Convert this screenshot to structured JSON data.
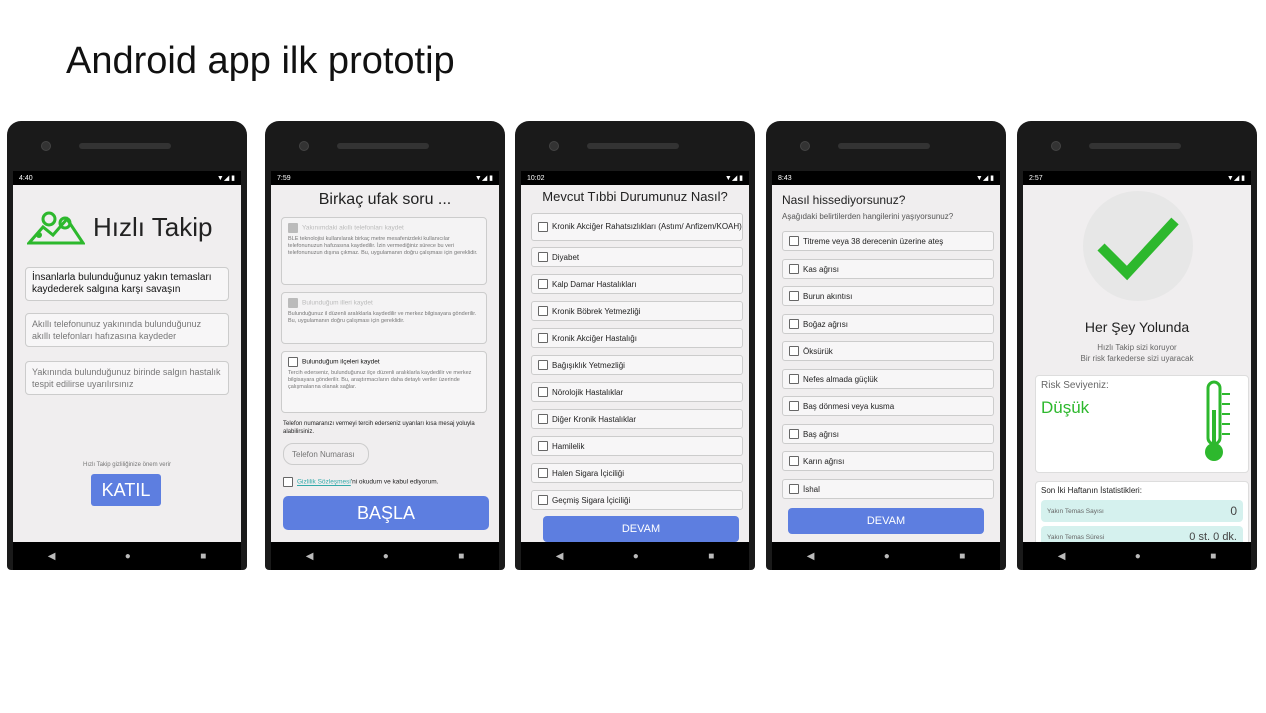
{
  "slide_title": "Android app ilk prototip",
  "phone1": {
    "time": "4:40",
    "app_name": "Hızlı Takip",
    "tagline": "İnsanlarla bulunduğunuz yakın temasları kaydederek salgına karşı savaşın",
    "info1": "Akıllı telefonunuz yakınında bulunduğunuz akıllı telefonları hafızasına kaydeder",
    "info2": "Yakınında bulunduğunuz birinde salgın hastalık tespit edilirse uyarılırsınız",
    "privacy_note": "Hızlı Takip gizliliğinize önem verir",
    "join_button": "KATIL"
  },
  "phone2": {
    "time": "7:59",
    "title": "Birkaç ufak soru ...",
    "q1_title": "Yakınımdaki akıllı telefonları kaydet",
    "q1_body": "BLE teknolojisi kullanılarak birkaç metre mesafenizdeki kullanıcılar telefonunuzun hafızasına kaydedilir. İzin vermediğiniz sürece bu veri telefonunuzun dışına çıkmaz. Bu, uygulamanın doğru çalışması için gereklidir.",
    "q2_title": "Bulunduğum illeri kaydet",
    "q2_body": "Bulunduğunuz il düzenli aralıklarla kaydedilir ve merkez bilgisayara gönderilir. Bu, uygulamanın doğru çalışması için gereklidir.",
    "q3_title": "Bulunduğum ilçeleri kaydet",
    "q3_body": "Tercih ederseniz, bulunduğunuz ilçe düzenli aralıklarla kaydedilir ve merkez bilgisayara gönderilir. Bu, araştırmacıların daha detaylı veriler üzerinde çalışmalarına olanak sağlar.",
    "phone_note": "Telefon numaranızı vermeyi tercih ederseniz uyarıları kısa mesaj yoluyla alabilirsiniz.",
    "phone_placeholder": "Telefon Numarası",
    "agreement_link": "Gizlilik Sözleşmesi",
    "agreement_rest": "'ni okudum ve kabul ediyorum.",
    "start_button": "BAŞLA"
  },
  "phone3": {
    "time": "10:02",
    "title": "Mevcut Tıbbi Durumunuz Nasıl?",
    "items": [
      "Kronik Akciğer Rahatsızlıkları (Astım/ Anfizem/KOAH)",
      "Diyabet",
      "Kalp Damar Hastalıkları",
      "Kronik Böbrek Yetmezliği",
      "Kronik Akciğer Hastalığı",
      "Bağışıklık Yetmezliği",
      "Nörolojik Hastalıklar",
      "Diğer Kronik Hastalıklar",
      "Hamilelik",
      "Halen Sigara İçiciliği",
      "Geçmiş Sigara İçiciliği"
    ],
    "continue_button": "DEVAM"
  },
  "phone4": {
    "time": "8:43",
    "title": "Nasıl hissediyorsunuz?",
    "subtitle": "Aşağıdaki belirtilerden hangilerini yaşıyorsunuz?",
    "items": [
      "Titreme veya 38 derecenin üzerine ateş",
      "Kas ağrısı",
      "Burun akıntısı",
      "Boğaz ağrısı",
      "Öksürük",
      "Nefes almada güçlük",
      "Baş dönmesi veya kusma",
      "Baş ağrısı",
      "Karın ağrısı",
      "İshal"
    ],
    "continue_button": "DEVAM"
  },
  "phone5": {
    "time": "2:57",
    "status_title": "Her Şey Yolunda",
    "line1": "Hızlı Takip sizi koruyor",
    "line2": "Bir risk farkederse sizi uyaracak",
    "risk_label": "Risk Seviyeniz:",
    "risk_value": "Düşük",
    "stats_title": "Son İki Haftanın İstatistikleri:",
    "stat1_label": "Yakın Temas Sayısı",
    "stat1_value": "0",
    "stat2_label": "Yakın Temas Süresi",
    "stat2_value": "0 st. 0 dk."
  },
  "colors": {
    "accent_blue": "#5d7ee0",
    "green": "#2db82d",
    "teal_card": "#d5f1ee"
  }
}
